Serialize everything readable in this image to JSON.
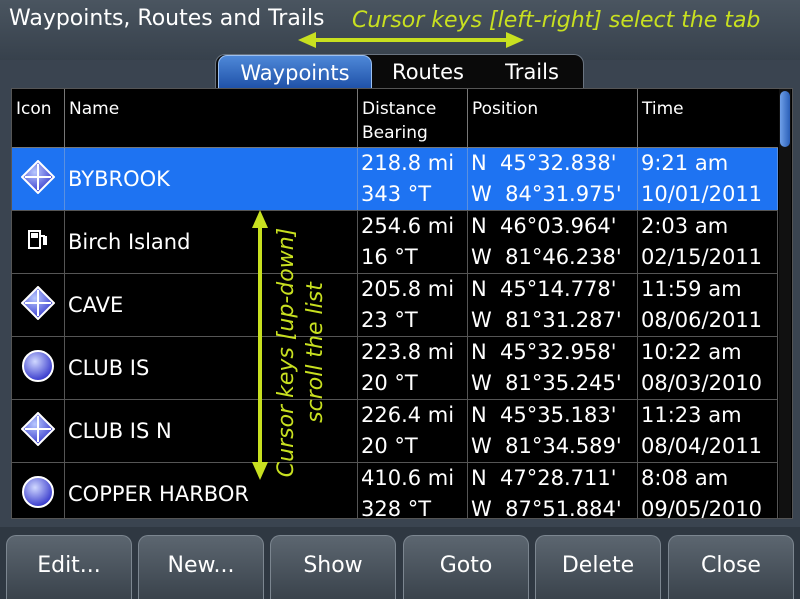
{
  "window": {
    "title": "Waypoints, Routes and Trails",
    "tab_hint": "Cursor keys [left-right] select the tab",
    "list_hint_line1": "Cursor keys [up-down]",
    "list_hint_line2": "scroll the list",
    "hint_color": "#c8e020"
  },
  "tabs": [
    {
      "label": "Waypoints",
      "active": true
    },
    {
      "label": "Routes",
      "active": false
    },
    {
      "label": "Trails",
      "active": false
    }
  ],
  "table": {
    "columns": {
      "icon": "Icon",
      "name": "Name",
      "distance_line1": "Distance",
      "distance_line2": "Bearing",
      "position": "Position",
      "time": "Time"
    },
    "rows": [
      {
        "icon": "diamond-cross-icon",
        "name": "BYBROOK",
        "distance": "218.8 mi",
        "bearing": "343 °T",
        "lat": "N  45°32.838'",
        "lon": "W  84°31.975'",
        "time": "9:21 am",
        "date": "10/01/2011",
        "selected": true
      },
      {
        "icon": "fuel-pump-icon",
        "name": "Birch Island",
        "distance": "254.6 mi",
        "bearing": "16 °T",
        "lat": "N  46°03.964'",
        "lon": "W  81°46.238'",
        "time": "2:03 am",
        "date": "02/15/2011",
        "selected": false
      },
      {
        "icon": "diamond-cross-icon",
        "name": "CAVE",
        "distance": "205.8 mi",
        "bearing": "23 °T",
        "lat": "N  45°14.778'",
        "lon": "W  81°31.287'",
        "time": "11:59 am",
        "date": "08/06/2011",
        "selected": false
      },
      {
        "icon": "blue-circle-icon",
        "name": "CLUB IS",
        "distance": "223.8 mi",
        "bearing": "20 °T",
        "lat": "N  45°32.958'",
        "lon": "W  81°35.245'",
        "time": "10:22 am",
        "date": "08/03/2010",
        "selected": false
      },
      {
        "icon": "diamond-cross-icon",
        "name": "CLUB IS N",
        "distance": "226.4 mi",
        "bearing": "20 °T",
        "lat": "N  45°35.183'",
        "lon": "W  81°34.589'",
        "time": "11:23 am",
        "date": "08/04/2011",
        "selected": false
      },
      {
        "icon": "blue-circle-icon",
        "name": "COPPER HARBOR",
        "distance": "410.6 mi",
        "bearing": "328 °T",
        "lat": "N  47°28.711'",
        "lon": "W  87°51.884'",
        "time": "8:08 am",
        "date": "09/05/2010",
        "selected": false
      }
    ]
  },
  "buttons": {
    "edit": "Edit...",
    "new": "New...",
    "show": "Show",
    "goto": "Goto",
    "delete": "Delete",
    "close": "Close"
  },
  "colors": {
    "selected_row": "#1e73f2",
    "active_tab": "#2a62c0"
  }
}
